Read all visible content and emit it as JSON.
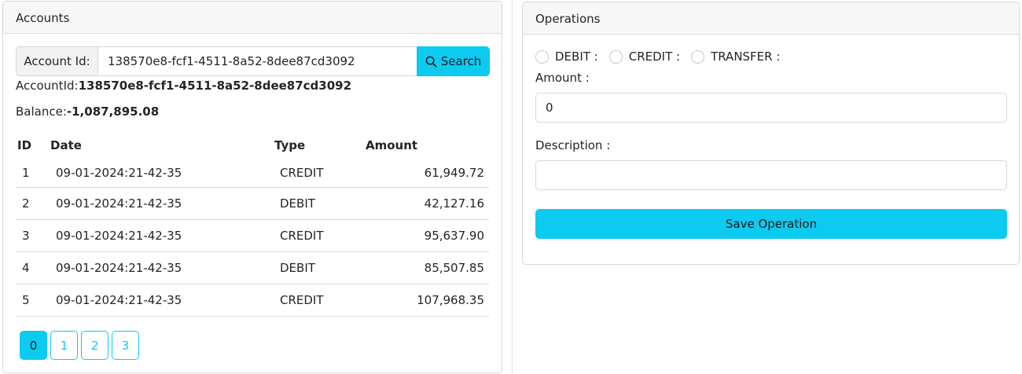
{
  "accounts": {
    "header": "Accounts",
    "search": {
      "label": "Account Id:",
      "value": "138570e8-fcf1-4511-8a52-8dee87cd3092",
      "button_label": "Search",
      "button_icon": "search-icon"
    },
    "account_id_label": "AccountId:",
    "account_id_value": "138570e8-fcf1-4511-8a52-8dee87cd3092",
    "balance_label": "Balance:",
    "balance_value": "-1,087,895.08",
    "table": {
      "headers": [
        "ID",
        "Date",
        "Type",
        "Amount"
      ],
      "rows": [
        {
          "id": "1",
          "date": "09-01-2024:21-42-35",
          "type": "CREDIT",
          "amount": "61,949.72"
        },
        {
          "id": "2",
          "date": "09-01-2024:21-42-35",
          "type": "DEBIT",
          "amount": "42,127.16"
        },
        {
          "id": "3",
          "date": "09-01-2024:21-42-35",
          "type": "CREDIT",
          "amount": "95,637.90"
        },
        {
          "id": "4",
          "date": "09-01-2024:21-42-35",
          "type": "DEBIT",
          "amount": "85,507.85"
        },
        {
          "id": "5",
          "date": "09-01-2024:21-42-35",
          "type": "CREDIT",
          "amount": "107,968.35"
        }
      ]
    },
    "pagination": {
      "pages": [
        "0",
        "1",
        "2",
        "3"
      ],
      "active": "0"
    }
  },
  "operations": {
    "header": "Operations",
    "radios": [
      "DEBIT :",
      "CREDIT :",
      "TRANSFER :"
    ],
    "amount_label": "Amount :",
    "amount_value": "0",
    "description_label": "Description :",
    "description_value": "",
    "save_label": "Save Operation"
  },
  "colors": {
    "accent": "#0dcaf0",
    "border": "#d6d6d6",
    "header_bg": "#f7f7f7"
  }
}
